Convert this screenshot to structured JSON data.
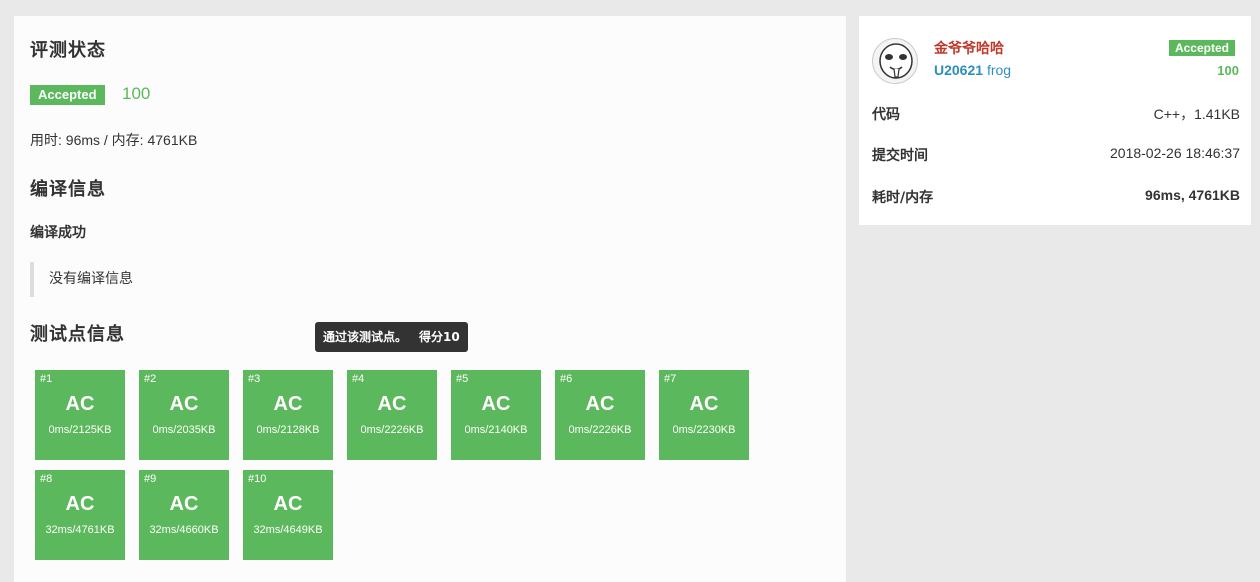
{
  "main": {
    "judge_status_title": "评测状态",
    "status_badge": "Accepted",
    "score": "100",
    "time_memory": "用时: 96ms / 内存: 4761KB",
    "compile_info_title": "编译信息",
    "compile_result": "编译成功",
    "compile_message": "没有编译信息",
    "testcase_title": "测试点信息",
    "tooltip": {
      "text": "通过该测试点。",
      "score": "得分10"
    },
    "testcases": [
      {
        "num": "#1",
        "result": "AC",
        "time_mem": "0ms/2125KB"
      },
      {
        "num": "#2",
        "result": "AC",
        "time_mem": "0ms/2035KB"
      },
      {
        "num": "#3",
        "result": "AC",
        "time_mem": "0ms/2128KB"
      },
      {
        "num": "#4",
        "result": "AC",
        "time_mem": "0ms/2226KB"
      },
      {
        "num": "#5",
        "result": "AC",
        "time_mem": "0ms/2140KB"
      },
      {
        "num": "#6",
        "result": "AC",
        "time_mem": "0ms/2226KB"
      },
      {
        "num": "#7",
        "result": "AC",
        "time_mem": "0ms/2230KB"
      },
      {
        "num": "#8",
        "result": "AC",
        "time_mem": "32ms/4761KB"
      },
      {
        "num": "#9",
        "result": "AC",
        "time_mem": "32ms/4660KB"
      },
      {
        "num": "#10",
        "result": "AC",
        "time_mem": "32ms/4649KB"
      }
    ]
  },
  "side": {
    "username": "金爷爷哈哈",
    "user_id": "U20621",
    "user_handle": "frog",
    "status_badge": "Accepted",
    "score": "100",
    "rows": [
      {
        "label": "代码",
        "value": "C++，1.41KB"
      },
      {
        "label": "提交时间",
        "value": "2018-02-26 18:46:37"
      },
      {
        "label": "耗时/内存",
        "value": "96ms, 4761KB"
      }
    ]
  },
  "colors": {
    "accent_green": "#5cb85c",
    "username_red": "#c0392b",
    "link_blue": "#2a8fbd"
  }
}
